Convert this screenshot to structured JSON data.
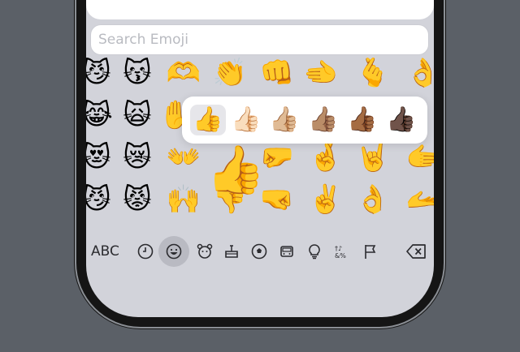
{
  "search": {
    "placeholder": "Search Emoji"
  },
  "keyboard": {
    "abc_label": "ABC",
    "categories": [
      "recent-icon",
      "smileys-icon",
      "animals-icon",
      "food-icon",
      "activity-icon",
      "travel-icon",
      "objects-icon",
      "symbols-icon",
      "flags-icon"
    ],
    "active_category": "smileys-icon"
  },
  "emojis": {
    "row1": [
      "😼",
      "😽",
      "🫶",
      "👏",
      "👊",
      "🫲",
      "🫰",
      "👌"
    ],
    "row2": [
      "😹",
      "🙀",
      "✋"
    ],
    "row3": [
      "😻",
      "😿",
      "👐",
      "🤛",
      "🤞",
      "🤘",
      "🫱"
    ],
    "row4": [
      "😼",
      "😾",
      "🙌",
      "👎",
      "🤜",
      "✌️",
      "👌",
      "🫴"
    ]
  },
  "skin_tone_popup": {
    "tones": [
      "👍",
      "👍🏻",
      "👍🏼",
      "👍🏽",
      "👍🏾",
      "👍🏿"
    ],
    "selected_index": 0,
    "preview": "👍"
  }
}
